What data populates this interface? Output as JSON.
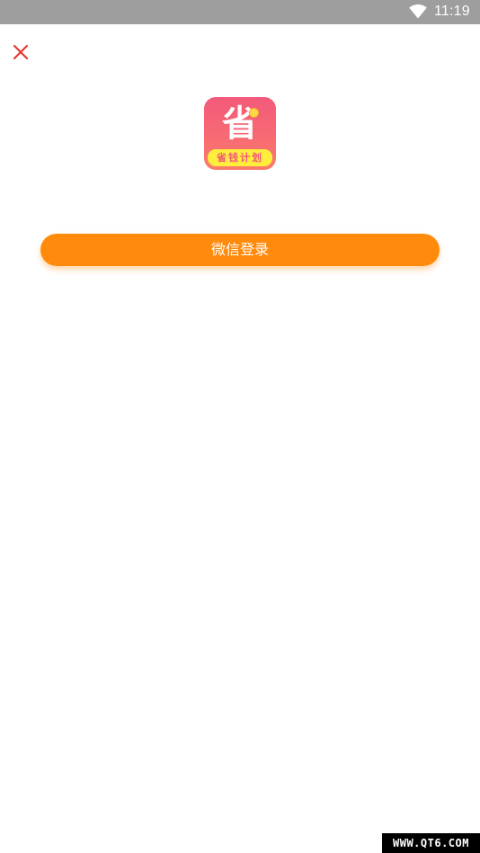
{
  "status_bar": {
    "time": "11:19",
    "wifi_icon": "wifi-icon",
    "background": "#9e9e9e"
  },
  "toolbar": {
    "close_icon": "close-icon",
    "close_color": "#e53935"
  },
  "app_logo": {
    "main_char": "省",
    "tagline": "省钱计划",
    "gradient_top": "#f35a7a",
    "band_color": "#ffee3b"
  },
  "login": {
    "wechat_label": "微信登录",
    "button_color": "#ff8a0c"
  },
  "watermark": {
    "text": "WWW.QT6.COM"
  }
}
